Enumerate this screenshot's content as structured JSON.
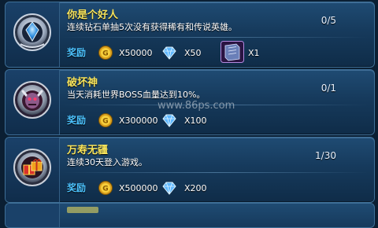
{
  "achievements": [
    {
      "title": "你是个好人",
      "desc": "连续钻石单抽5次没有获得稀有和传说英雄。",
      "progress": "0/5",
      "reward_label": "奖励",
      "coin_amount": "X50000",
      "gem_amount": "X50",
      "item_amount": "X1",
      "badge_icon": "blue-gem-medal-icon"
    },
    {
      "title": "破坏神",
      "desc": "当天消耗世界BOSS血量达到10%。",
      "progress": "0/1",
      "reward_label": "奖励",
      "coin_amount": "X300000",
      "gem_amount": "X100",
      "badge_icon": "demon-skull-medal-icon"
    },
    {
      "title": "万寿无疆",
      "desc": "连续30天登入游戏。",
      "progress": "1/30",
      "reward_label": "奖励",
      "coin_amount": "X500000",
      "gem_amount": "X200",
      "badge_icon": "gift-box-medal-icon"
    }
  ],
  "watermark": "www.86ps.com",
  "colors": {
    "title": "#f6e35c",
    "reward_label": "#4cc3ff",
    "card_bg": "#1a4169"
  }
}
